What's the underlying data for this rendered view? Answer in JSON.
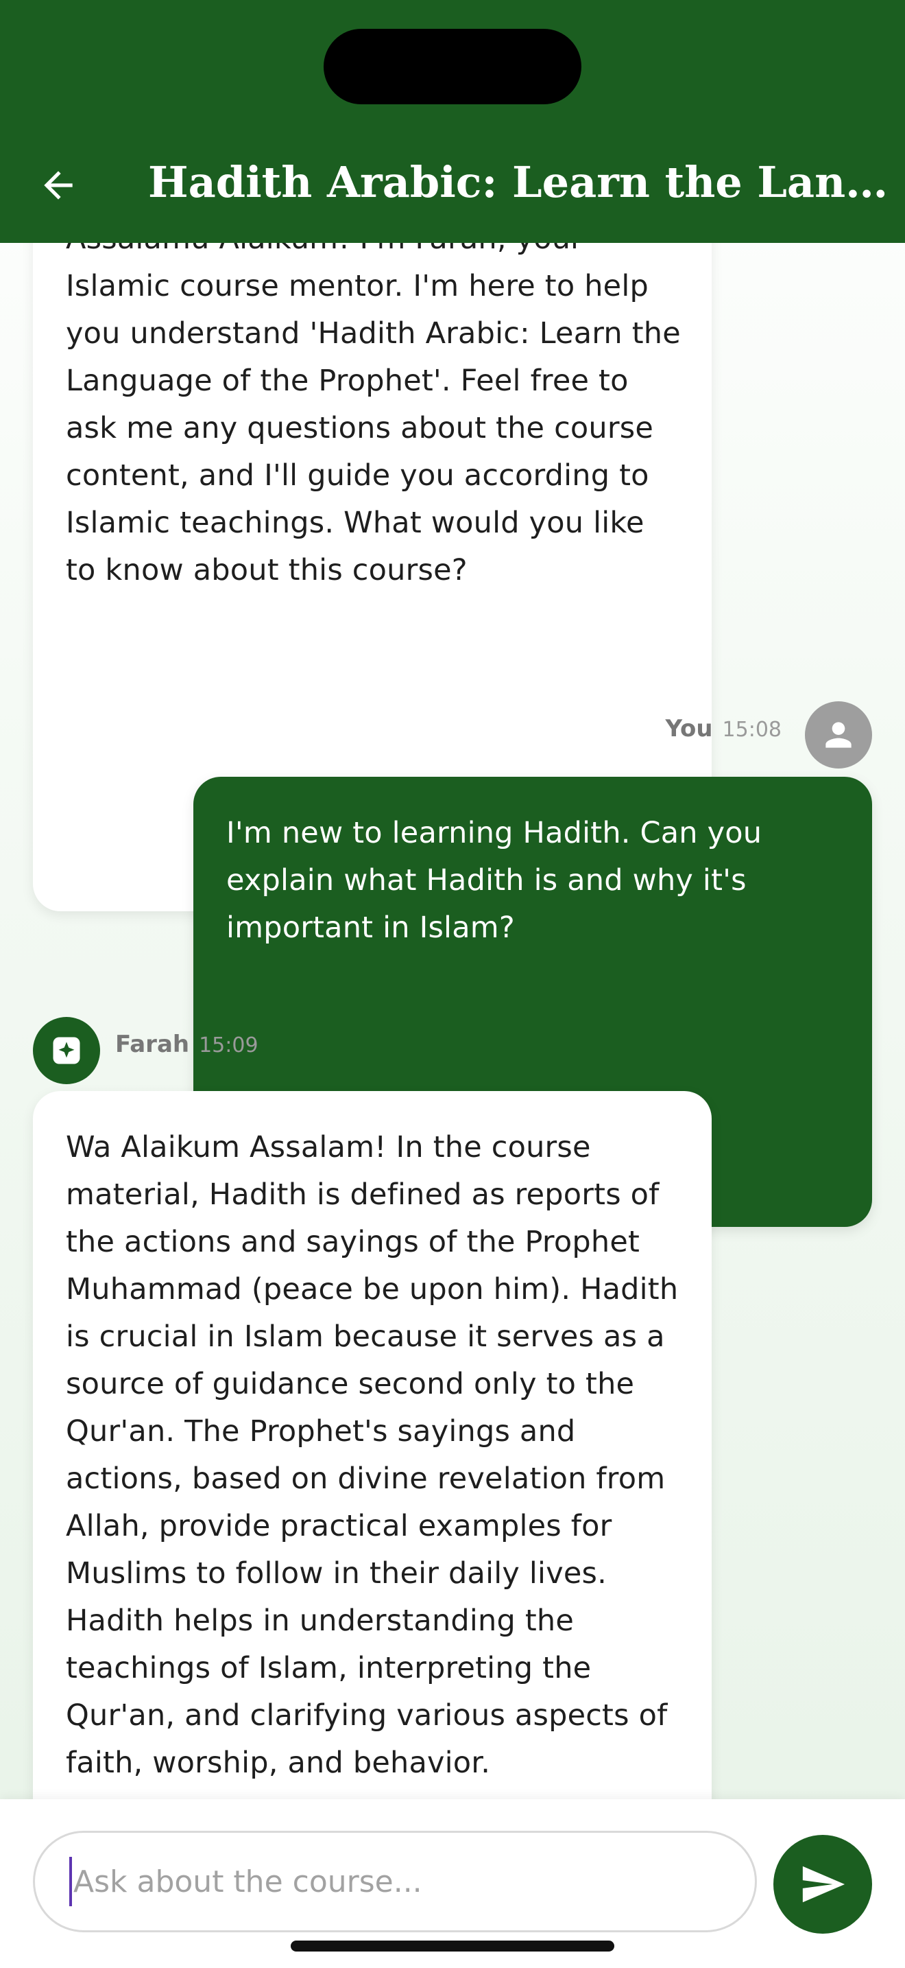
{
  "header": {
    "title": "Hadith Arabic: Learn the Language of the Prophet",
    "back_icon": "arrow-left-icon"
  },
  "messages": [
    {
      "role": "assistant",
      "text": "Assalamu Alaikum! I'm Farah, your Islamic course mentor. I'm here to help you understand 'Hadith Arabic: Learn the Language of the Prophet'. Feel free to ask me any questions about the course content, and I'll guide you according to Islamic teachings. What would you like to know about this course?"
    },
    {
      "role": "user",
      "sender": "You",
      "time": "15:08",
      "avatar_icon": "person-icon",
      "text": "I'm new to learning Hadith. Can you explain what Hadith is and why it's important in Islam?"
    },
    {
      "role": "assistant",
      "sender": "Farah",
      "time": "15:09",
      "avatar_icon": "sparkle-icon",
      "text": "Wa Alaikum Assalam! In the course material, Hadith is defined as reports of the actions and sayings of the Prophet Muhammad (peace be upon him). Hadith is crucial in Islam because it serves as a source of guidance second only to the Qur'an. The Prophet's sayings and actions, based on divine revelation from Allah, provide practical examples for Muslims to follow in their daily lives. Hadith helps in understanding the teachings of Islam, interpreting the Qur'an, and clarifying various aspects of faith, worship, and behavior."
    }
  ],
  "composer": {
    "placeholder": "Ask about the course...",
    "send_icon": "send-icon"
  },
  "colors": {
    "primary": "#1b5e20",
    "assistant_bubble": "#ffffff",
    "user_avatar": "#9e9e9e",
    "caret": "#5e35b1"
  }
}
